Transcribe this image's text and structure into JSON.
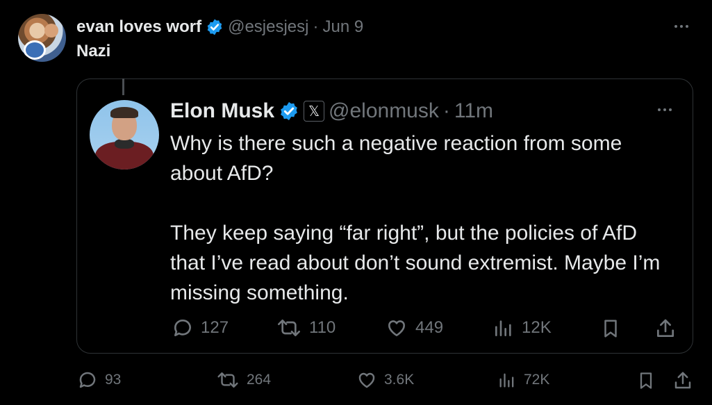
{
  "outer": {
    "name": "evan loves worf",
    "handle": "@esjesjesj",
    "dot": "·",
    "time": "Jun 9",
    "text": "Nazi",
    "stats": {
      "replies": "93",
      "reposts": "264",
      "likes": "3.6K",
      "views": "72K"
    }
  },
  "quote": {
    "name": "Elon Musk",
    "badge": "𝕏",
    "handle": "@elonmusk",
    "dot": "·",
    "time": "11m",
    "paragraph1": "Why is there such a negative reaction from some about AfD?",
    "paragraph2": "They keep saying “far right”, but the policies of AfD that I’ve read about don’t sound extremist. Maybe I’m missing something.",
    "stats": {
      "replies": "127",
      "reposts": "110",
      "likes": "449",
      "views": "12K"
    }
  },
  "colors": {
    "background": "#000000",
    "text": "#e7e9ea",
    "muted": "#71767b",
    "verified": "#1d9bf0",
    "border": "#2f3336"
  }
}
